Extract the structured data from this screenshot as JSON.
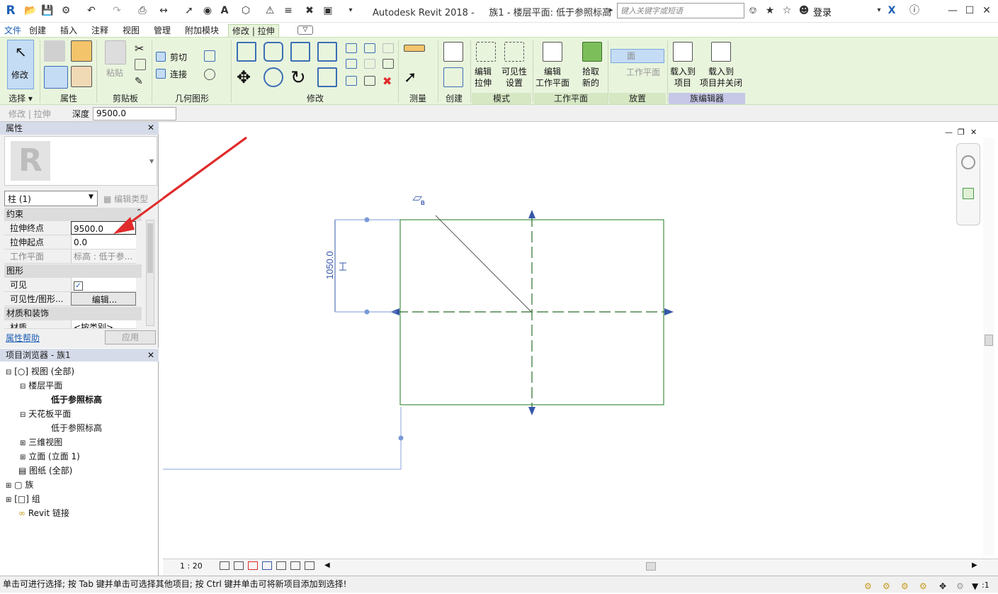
{
  "titlebar": {
    "app_title": "Autodesk Revit 2018 -     族1 - 楼层平面: 低于参照标高",
    "search_placeholder": "键入关键字或短语",
    "login_label": "登录"
  },
  "tabs": [
    "文件",
    "创建",
    "插入",
    "注释",
    "视图",
    "管理",
    "附加模块",
    "修改 | 拉伸"
  ],
  "ribbon": {
    "select_panel": {
      "modify_label": "修改",
      "panel_label": "选择 ▾"
    },
    "properties_panel": {
      "panel_label": "属性"
    },
    "clipboard_panel": {
      "paste_label": "粘贴",
      "panel_label": "剪贴板"
    },
    "geometry_panel": {
      "cut_label": "剪切",
      "join_label": "连接",
      "panel_label": "几何图形"
    },
    "modify_panel": {
      "panel_label": "修改"
    },
    "measure_panel": {
      "panel_label": "测量"
    },
    "create_panel": {
      "panel_label": "创建"
    },
    "mode_panel": {
      "edit_extrusion_label": "编辑\n拉伸",
      "visibility_label": "可见性\n设置",
      "panel_label": "模式"
    },
    "workplane_panel": {
      "edit_workplane_label": "编辑\n工作平面",
      "panel_label": "工作平面"
    },
    "pick_panel": {
      "pick_new_label": "拾取\n新的"
    },
    "place_panel": {
      "face_label": "面",
      "workplane_label": "工作平面",
      "panel_label": "放置"
    },
    "family_editor_panel": {
      "load_label": "载入到\n项目",
      "load_close_label": "载入到\n项目并关闭",
      "panel_label": "族编辑器"
    }
  },
  "options_bar": {
    "context": "修改 | 拉伸",
    "depth_label": "深度",
    "depth_value": "9500.0"
  },
  "properties": {
    "header": "属性",
    "type_selector": "柱 (1)",
    "edit_type": "编辑类型",
    "sections": {
      "constraints": "约束",
      "graphics": "图形",
      "materials": "材质和装饰"
    },
    "rows": {
      "extrusion_end_label": "拉伸终点",
      "extrusion_end_value": "9500.0",
      "extrusion_start_label": "拉伸起点",
      "extrusion_start_value": "0.0",
      "workplane_label": "工作平面",
      "workplane_value": "标高 : 低于参...",
      "visible_label": "可见",
      "visible_value": "✓",
      "vis_graphics_label": "可见性/图形...",
      "vis_graphics_button": "编辑...",
      "material_label": "材质",
      "material_value": "<按类别>"
    },
    "help_link": "属性帮助",
    "apply_button": "应用"
  },
  "project_browser": {
    "header": "项目浏览器 - 族1",
    "nodes": {
      "views": "视图 (全部)",
      "floor_plans": "楼层平面",
      "below_ref_level": "低于参照标高",
      "ceiling_plans": "天花板平面",
      "ceiling_below_ref": "低于参照标高",
      "views_3d": "三维视图",
      "elevations": "立面 (立面 1)",
      "sheets": "图纸 (全部)",
      "families": "族",
      "groups": "组",
      "revit_links": "Revit 链接"
    }
  },
  "canvas": {
    "dimension_text": "1050.0",
    "workplane_tag": "B"
  },
  "view_control_bar": {
    "scale": "1 : 20"
  },
  "status_bar": {
    "message": "单击可进行选择; 按 Tab 键并单击可选择其他项目; 按 Ctrl 键并单击可将新项目添加到选择!",
    "filter_count": ":1"
  },
  "colors": {
    "ribbon_bg": "#e9f4dd",
    "sketch_line": "#1d7a1d",
    "ref_plane": "#2a6d2a",
    "dim_color": "#3657a8",
    "arrow_red": "#e02b2b"
  }
}
